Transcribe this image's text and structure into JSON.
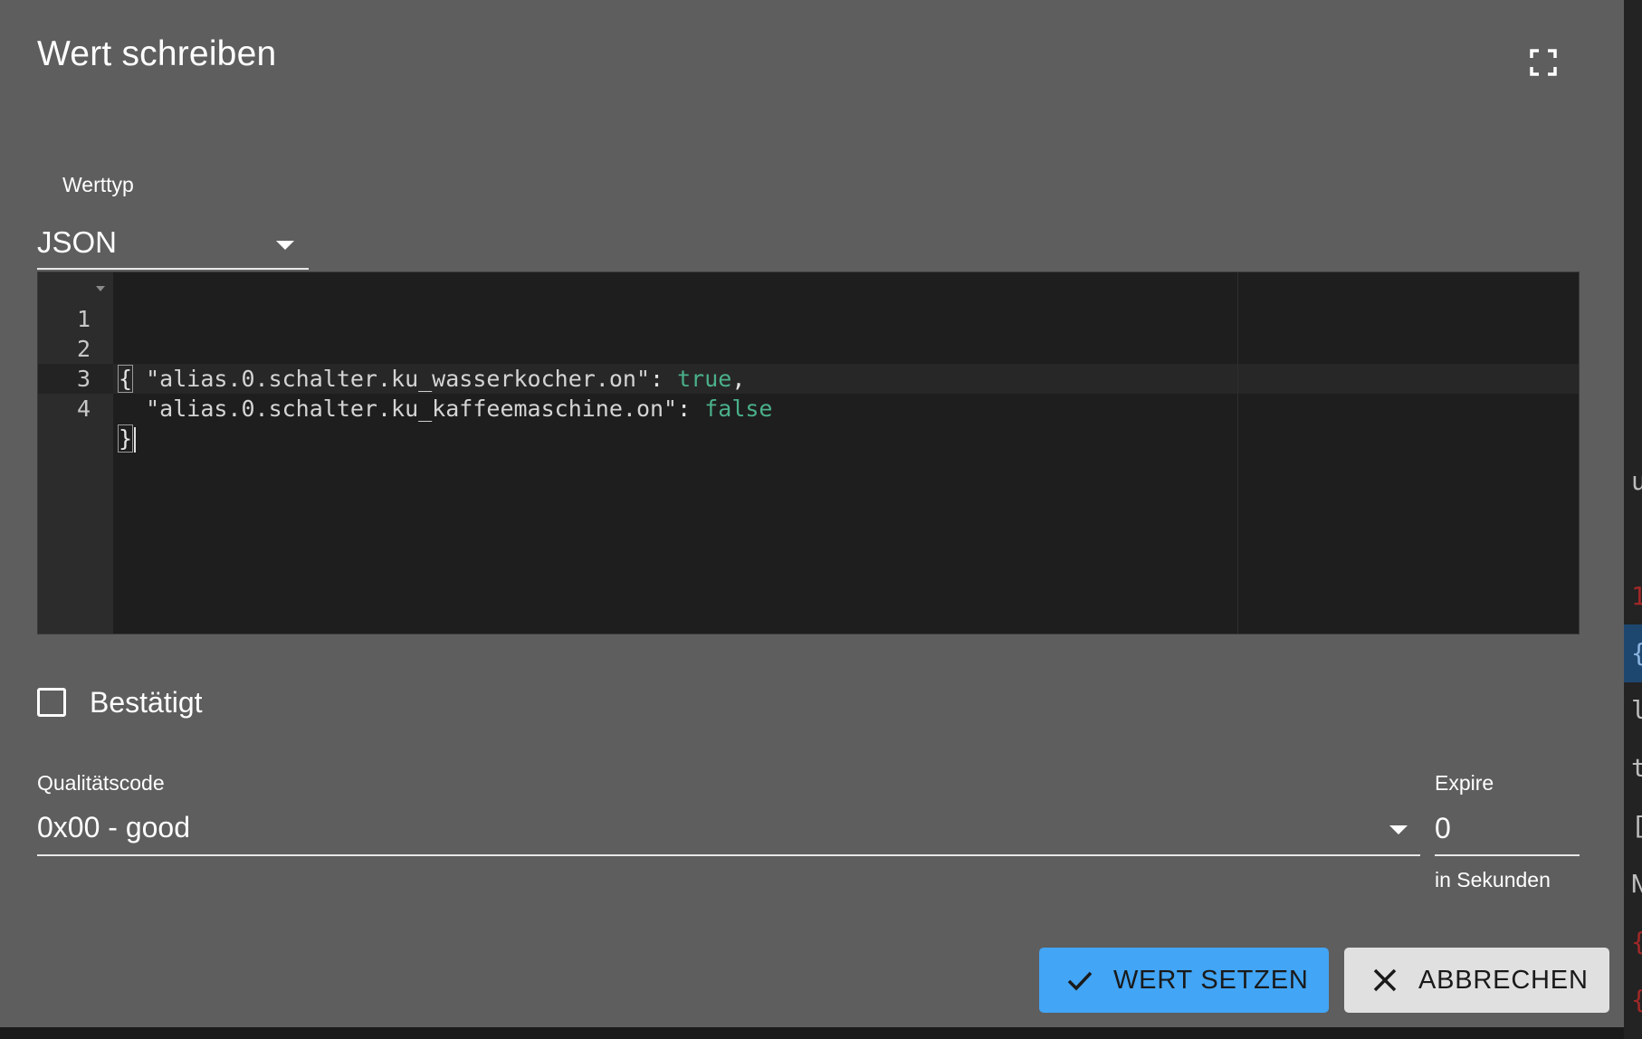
{
  "dialog": {
    "title": "Wert schreiben"
  },
  "value_type": {
    "label": "Werttyp",
    "selected": "JSON"
  },
  "editor": {
    "lines": [
      {
        "number": "1",
        "text": "{"
      },
      {
        "number": "2",
        "key": "\"alias.0.schalter.ku_wasserkocher.on\"",
        "sep": ": ",
        "value": "true",
        "trail": ","
      },
      {
        "number": "3",
        "key": "\"alias.0.schalter.ku_kaffeemaschine.on\"",
        "sep": ": ",
        "value": "false",
        "trail": ""
      },
      {
        "number": "4",
        "text": "}"
      }
    ]
  },
  "acknowledged": {
    "label": "Bestätigt",
    "checked": false
  },
  "quality": {
    "label": "Qualitätscode",
    "selected": "0x00 - good"
  },
  "expire": {
    "label": "Expire",
    "value": "0",
    "helper": "in Sekunden"
  },
  "actions": {
    "submit_label": "WERT SETZEN",
    "cancel_label": "ABBRECHEN"
  },
  "colors": {
    "primary": "#42a5f5",
    "dialog_bg": "#5e5e5e",
    "editor_bg": "#1e1e1e",
    "keyword": "#4ab08a"
  }
}
